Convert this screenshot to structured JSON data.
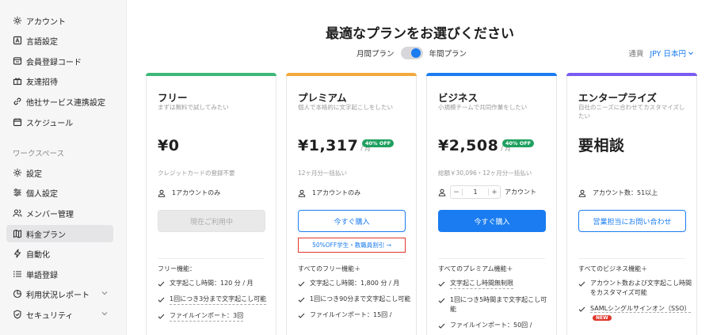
{
  "sidebar": {
    "items": [
      {
        "label": "アカウント",
        "icon": "gear-icon"
      },
      {
        "label": "言語設定",
        "icon": "language-icon"
      },
      {
        "label": "会員登録コード",
        "icon": "code-icon"
      },
      {
        "label": "友達招待",
        "icon": "gift-icon"
      },
      {
        "label": "他社サービス連携設定",
        "icon": "link-icon"
      },
      {
        "label": "スケジュール",
        "icon": "calendar-icon"
      }
    ],
    "section_label": "ワークスペース",
    "workspace_items": [
      {
        "label": "設定",
        "icon": "gear-icon"
      },
      {
        "label": "個人設定",
        "icon": "sliders-icon"
      },
      {
        "label": "メンバー管理",
        "icon": "users-icon"
      },
      {
        "label": "料金プラン",
        "icon": "map-icon",
        "active": true
      },
      {
        "label": "自動化",
        "icon": "bolt-icon"
      },
      {
        "label": "単語登録",
        "icon": "list-icon"
      },
      {
        "label": "利用状況レポート",
        "icon": "chart-pie-icon",
        "expandable": true
      },
      {
        "label": "セキュリティ",
        "icon": "shield-icon",
        "expandable": true
      }
    ]
  },
  "header": {
    "title": "最適なプランをお選びください",
    "toggle_monthly": "月間プラン",
    "toggle_yearly": "年間プラン",
    "currency_label": "通貨",
    "currency_value": "JPY 日本円"
  },
  "colors": {
    "free": "#3cb878",
    "premium": "#f2a93b",
    "business": "#1a7cf0",
    "enterprise": "#7b5cf0",
    "accent": "#1a7cf0"
  },
  "plans": {
    "free": {
      "name": "フリー",
      "desc": "まずは無料で試してみたい",
      "price": "¥0",
      "note": "クレジットカードの登録不要",
      "accounts": "1アカウントのみ",
      "button": "現在ご利用中",
      "features_title": "フリー機能：",
      "features": [
        "文字起こし時間：120 分 / 月",
        "1回につき3分まで文字起こし可能",
        "ファイルインポート：3回"
      ]
    },
    "premium": {
      "name": "プレミアム",
      "desc": "個人で本格的に文字起こしをしたい",
      "price": "¥1,317",
      "unit": "/ 月",
      "badge": "40% OFF",
      "note": "12ヶ月分一括払い",
      "accounts": "1アカウントのみ",
      "button": "今すぐ購入",
      "student_link": "50%OFF学生・教職員割引 →",
      "features_title": "すべてのフリー機能＋",
      "features": [
        "文字起こし時間：1,800 分 / 月",
        "1回につき90分まで文字起こし可能",
        "ファイルインポート：15回 /"
      ]
    },
    "business": {
      "name": "ビジネス",
      "desc": "小規模チームで共同作業をしたい",
      "price": "¥2,508",
      "unit": "/ 月",
      "badge": "40% OFF",
      "note": "総額￥30,096・12ヶ月分一括払い",
      "stepper_minus": "−",
      "stepper_value": "1",
      "stepper_plus": "+",
      "stepper_label": "アカウント",
      "button": "今すぐ購入",
      "features_title": "すべてのプレミアム機能＋",
      "features": [
        "文字起こし時間無制限",
        "1回につき5時間まで文字起こし可能",
        "ファイルインポート：50回 /"
      ]
    },
    "enterprise": {
      "name": "エンタープライズ",
      "desc": "自社のニーズに合わせてカスタマイズしたい",
      "price": "要相談",
      "accounts": "アカウント数：51以上",
      "button": "営業担当にお問い合わせ",
      "features_title": "すべてのビジネス機能＋",
      "features": [
        "アカウント数および文字起こし時間をカスタマイズ可能",
        "SAMLシングルサインオン（SSO）"
      ],
      "new_badge": "NEW"
    }
  }
}
